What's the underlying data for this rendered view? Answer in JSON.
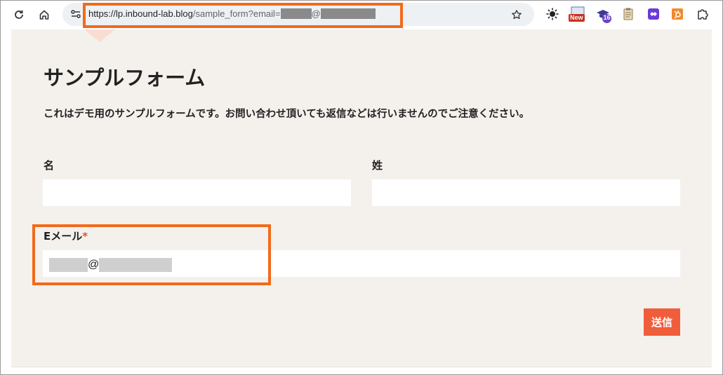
{
  "browser": {
    "url_host": "https://lp.inbound-lab.blog",
    "url_path": "/sample_form?email=",
    "url_at": "@",
    "extensions": [
      {
        "name": "new",
        "badge": "New"
      },
      {
        "name": "graduation",
        "badge": "16"
      }
    ]
  },
  "form": {
    "title": "サンプルフォーム",
    "description": "これはデモ用のサンプルフォームです。お問い合わせ頂いても返信などは行いませんのでご注意ください。",
    "first_name_label": "名",
    "last_name_label": "姓",
    "email_label": "Eメール",
    "required_mark": "*",
    "email_at": "@",
    "submit_label": "送信"
  },
  "colors": {
    "accent": "#ef5d3a",
    "highlight": "#f26a1b",
    "page_bg": "#f4f1ed"
  }
}
